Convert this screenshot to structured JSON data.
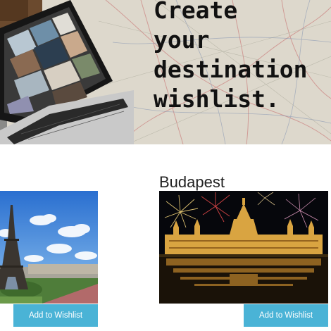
{
  "hero": {
    "title": "Create\nyour\ndestination\nwishlist."
  },
  "destinations": [
    {
      "name": "",
      "button_label": "Add to Wishlist"
    },
    {
      "name": "Budapest",
      "button_label": "Add to Wishlist"
    }
  ],
  "colors": {
    "button_bg": "#4ab3d6",
    "button_text": "#ffffff",
    "map_bg": "#ded9cc"
  }
}
